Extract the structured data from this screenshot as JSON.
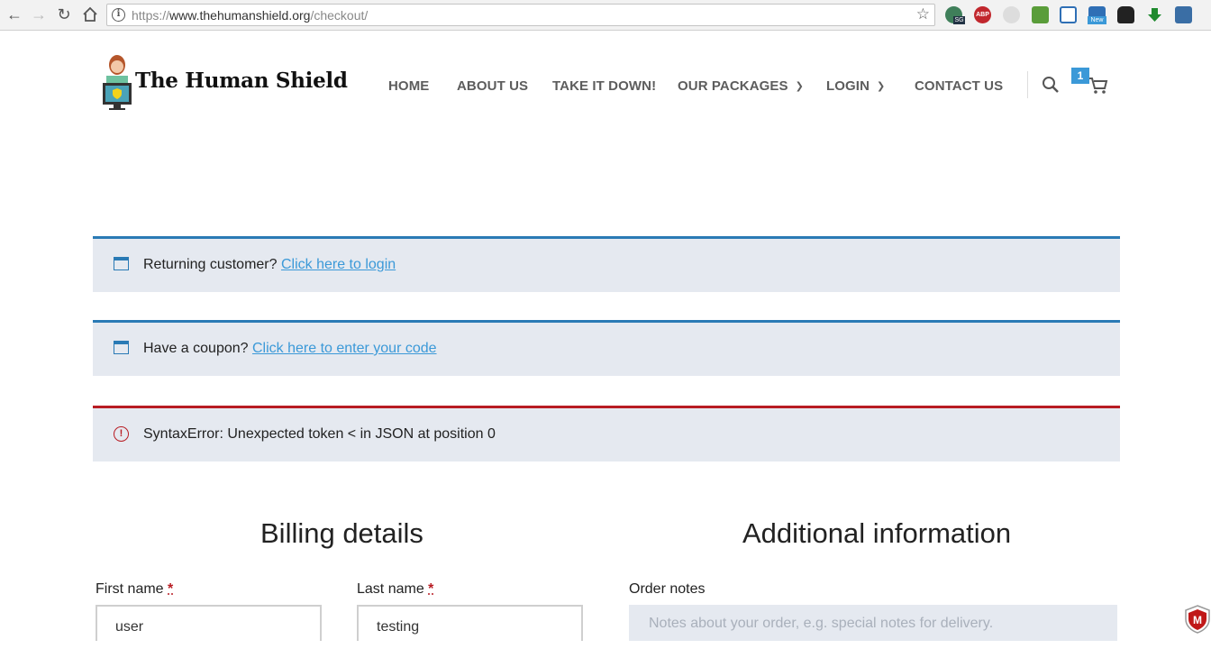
{
  "browser": {
    "url_protocol": "https://",
    "url_host": "www.thehumanshield.org",
    "url_path": "/checkout/",
    "back_icon": "arrow-left-icon",
    "forward_icon": "arrow-right-icon",
    "reload_icon": "reload-icon",
    "home_icon": "home-icon",
    "extensions": [
      "globe-sg-icon",
      "adblock-icon",
      "chat-icon",
      "evernote-icon",
      "calendar-icon",
      "new-badge-icon",
      "ghostery-icon",
      "download-arrow-icon",
      "profile-icon"
    ]
  },
  "site": {
    "logo_text": "The Human Shield",
    "nav": [
      {
        "label": "HOME"
      },
      {
        "label": "ABOUT US"
      },
      {
        "label": "TAKE IT DOWN!"
      },
      {
        "label": "OUR PACKAGES",
        "dropdown": true
      },
      {
        "label": "LOGIN",
        "dropdown": true
      },
      {
        "label": "CONTACT US"
      }
    ],
    "cart_count": "1",
    "accent_color": "#3b99d8"
  },
  "notices": {
    "login": {
      "text": "Returning customer?",
      "link": "Click here to login"
    },
    "coupon": {
      "text": "Have a coupon?",
      "link": "Click here to enter your code"
    },
    "error": {
      "text": "SyntaxError: Unexpected token < in JSON at position 0",
      "color": "#b81c23"
    }
  },
  "billing": {
    "heading": "Billing details",
    "first_name_label": "First name",
    "first_name_value": "user",
    "last_name_label": "Last name",
    "last_name_value": "testing",
    "required_mark": "*"
  },
  "additional": {
    "heading": "Additional information",
    "order_notes_label": "Order notes",
    "order_notes_placeholder": "Notes about your order, e.g. special notes for delivery."
  }
}
